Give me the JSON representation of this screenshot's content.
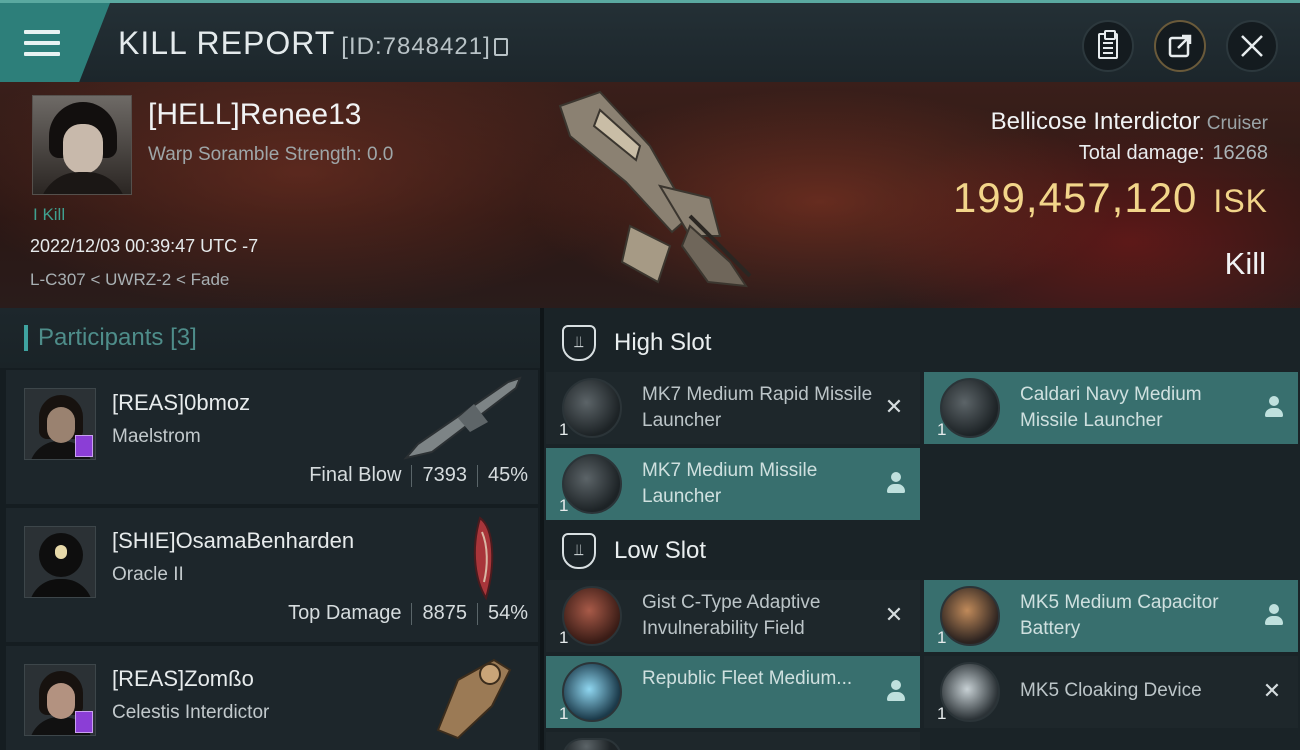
{
  "header": {
    "title": "KILL REPORT",
    "kill_id": "[ID:7848421]"
  },
  "victim": {
    "name": "[HELL]Renee13",
    "scramble": "Warp Soramble Strength: 0.0",
    "kills": "I Kill",
    "timestamp": "2022/12/03 00:39:47 UTC -7",
    "location": "L-C307 < UWRZ-2 < Fade",
    "ship": "Bellicose Interdictor",
    "ship_class": "Cruiser",
    "total_damage_label": "Total damage:",
    "total_damage": "16268",
    "isk_value": "199,457,120",
    "isk_unit": "ISK",
    "report_type": "Kill"
  },
  "participants": {
    "title": "Participants",
    "count": "[3]",
    "rows": [
      {
        "name": "[REAS]0bmoz",
        "ship": "Maelstrom",
        "tag": "Final Blow",
        "damage": "7393",
        "percent": "45%"
      },
      {
        "name": "[SHIE]OsamaBenharden",
        "ship": "Oracle II",
        "tag": "Top Damage",
        "damage": "8875",
        "percent": "54%"
      },
      {
        "name": "[REAS]Zomßo",
        "ship": "Celestis Interdictor"
      }
    ]
  },
  "fitting": {
    "high_slot": {
      "title": "High Slot",
      "modules": [
        {
          "name": "MK7 Medium Rapid Missile Launcher",
          "qty": "1",
          "status": "destroyed"
        },
        {
          "name": "Caldari Navy Medium Missile Launcher",
          "qty": "1",
          "status": "dropped"
        },
        {
          "name": "MK7 Medium Missile Launcher",
          "qty": "1",
          "status": "dropped"
        }
      ]
    },
    "low_slot": {
      "title": "Low Slot",
      "modules": [
        {
          "name": "Gist C-Type Adaptive Invulnerability Field",
          "qty": "1",
          "status": "destroyed"
        },
        {
          "name": "MK5 Medium Capacitor Battery",
          "qty": "1",
          "status": "dropped"
        },
        {
          "name": "Republic Fleet Medium...",
          "qty": "1",
          "status": "dropped"
        },
        {
          "name": "MK5 Cloaking Device",
          "qty": "1",
          "status": "destroyed"
        }
      ]
    },
    "destroyed_glyph": "✕"
  },
  "colors": {
    "accent_teal": "#2d7f7a",
    "dropped_bg": "#386f6e",
    "isk_gold": "#f2d58a"
  },
  "icons": [
    "menu-icon",
    "clipboard-icon",
    "share-icon",
    "close-icon",
    "shield-slot-icon",
    "person-icon",
    "copy-icon"
  ]
}
